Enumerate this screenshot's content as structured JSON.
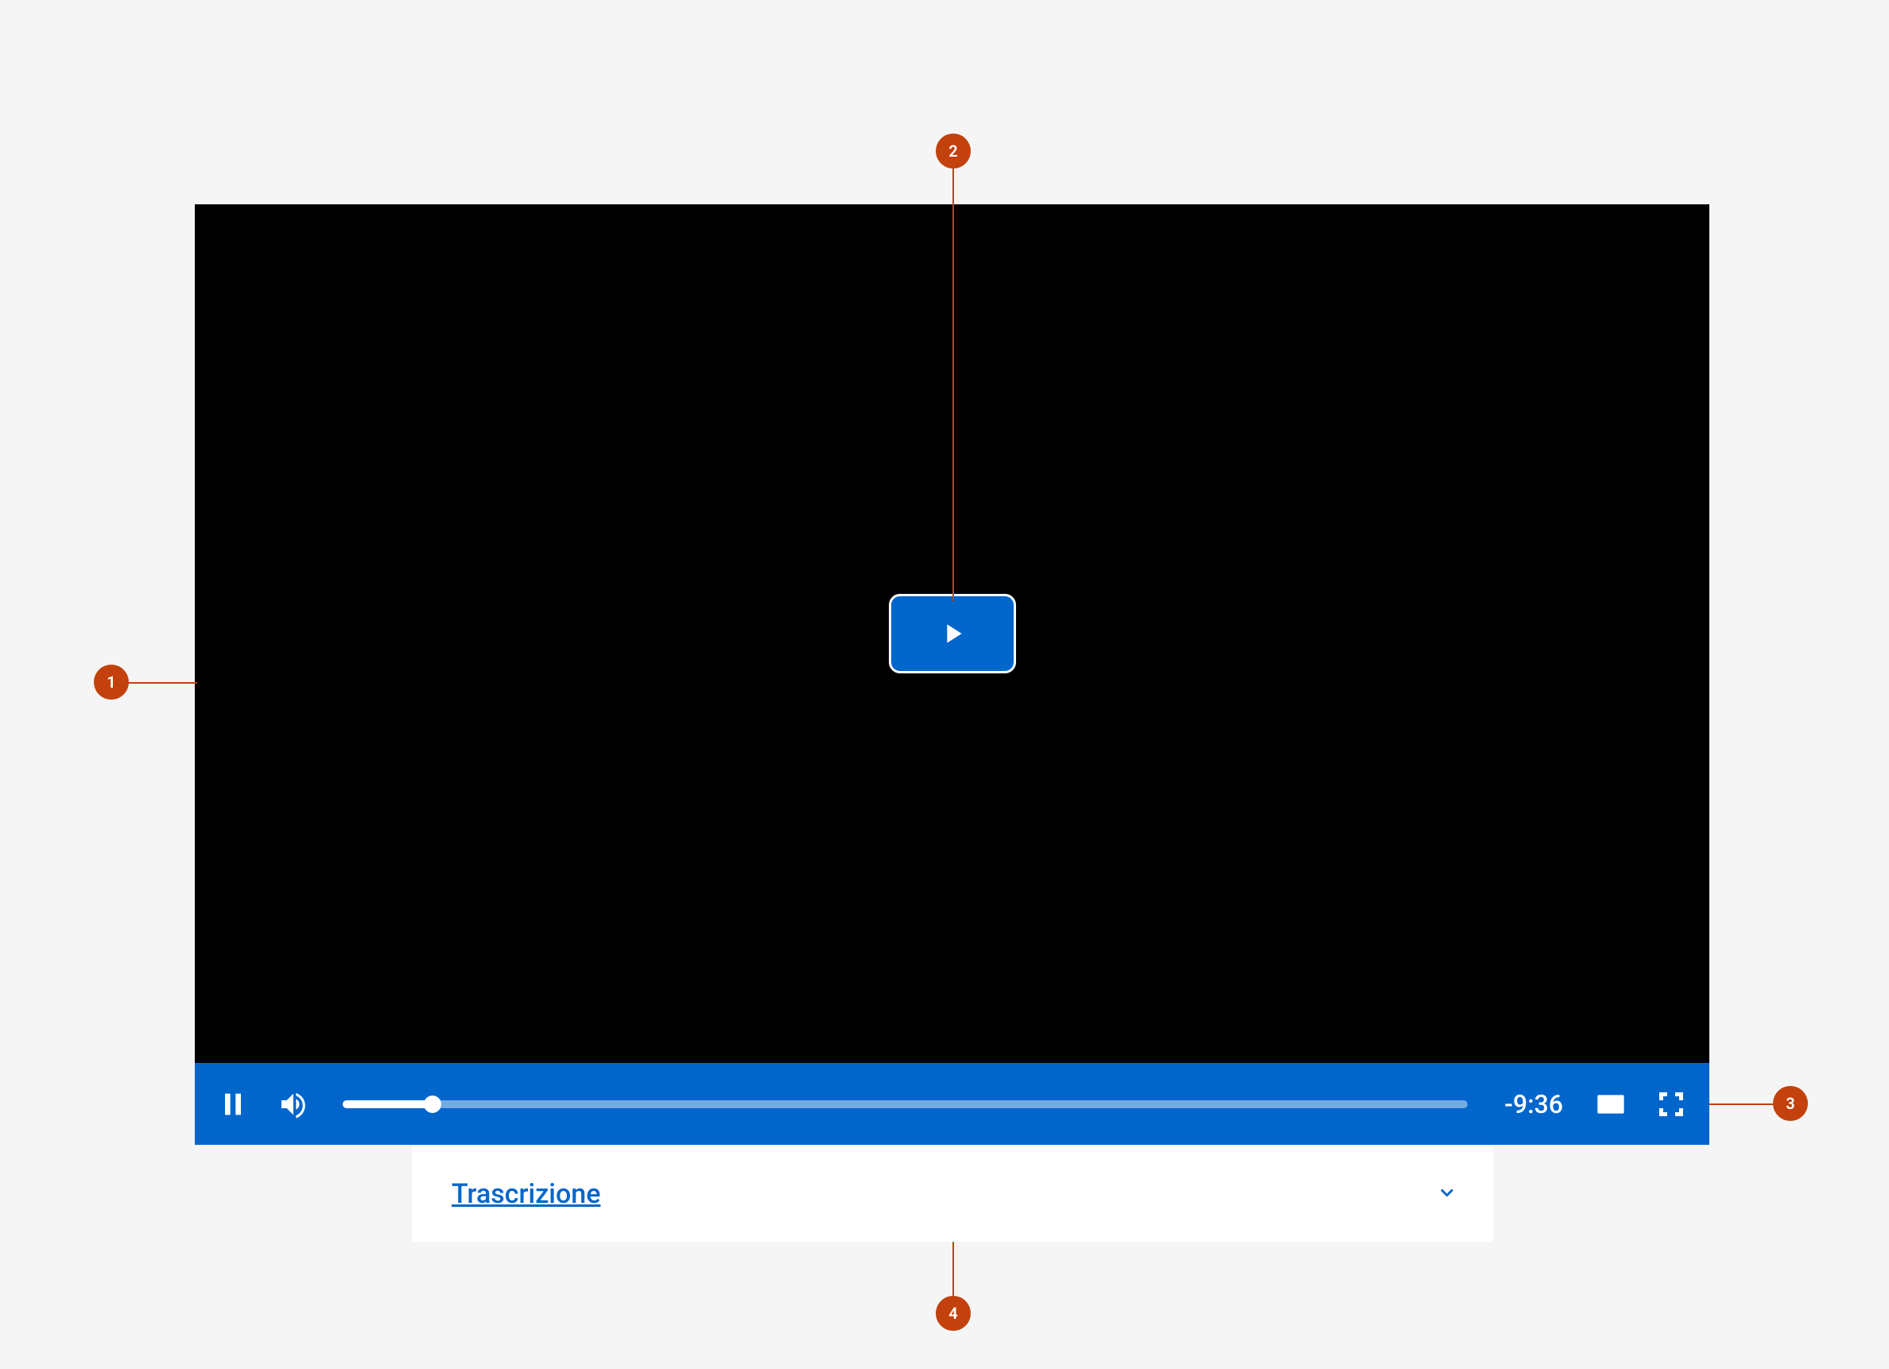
{
  "player": {
    "time_remaining": "-9:36",
    "progress_percent": 8
  },
  "transcription": {
    "label": "Trascrizione"
  },
  "annotations": {
    "a1": "1",
    "a2": "2",
    "a3": "3",
    "a4": "4"
  }
}
